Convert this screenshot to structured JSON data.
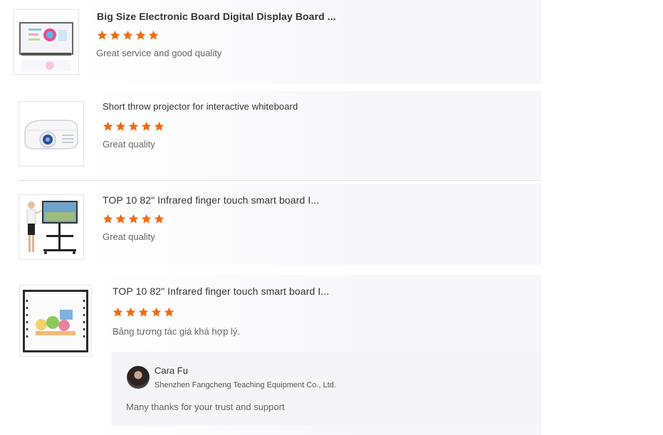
{
  "reviews": [
    {
      "title": "Big Size Electronic Board Digital Display Board ...",
      "rating": 5,
      "comment": "Great service and good quality",
      "thumb_icon": "digital-display-board-image"
    },
    {
      "title": "Short throw projector for interactive whiteboard",
      "rating": 5,
      "comment": "Great quality",
      "thumb_icon": "projector-image"
    },
    {
      "title": "TOP 10 82\" Infrared finger touch smart board I...",
      "rating": 5,
      "comment": "Great quality",
      "thumb_icon": "smart-board-stand-image"
    },
    {
      "title": "TOP 10 82\" Infrared finger touch smart board I...",
      "rating": 5,
      "comment": "Bảng tương tác giá khá hợp lý.",
      "thumb_icon": "whiteboard-image"
    }
  ],
  "reply": {
    "name": "Cara Fu",
    "company": "Shenzhen Fangcheng Teaching Equipment Co., Ltd.",
    "text": "Many thanks for your trust and support"
  },
  "colors": {
    "star": "#f26a10"
  }
}
